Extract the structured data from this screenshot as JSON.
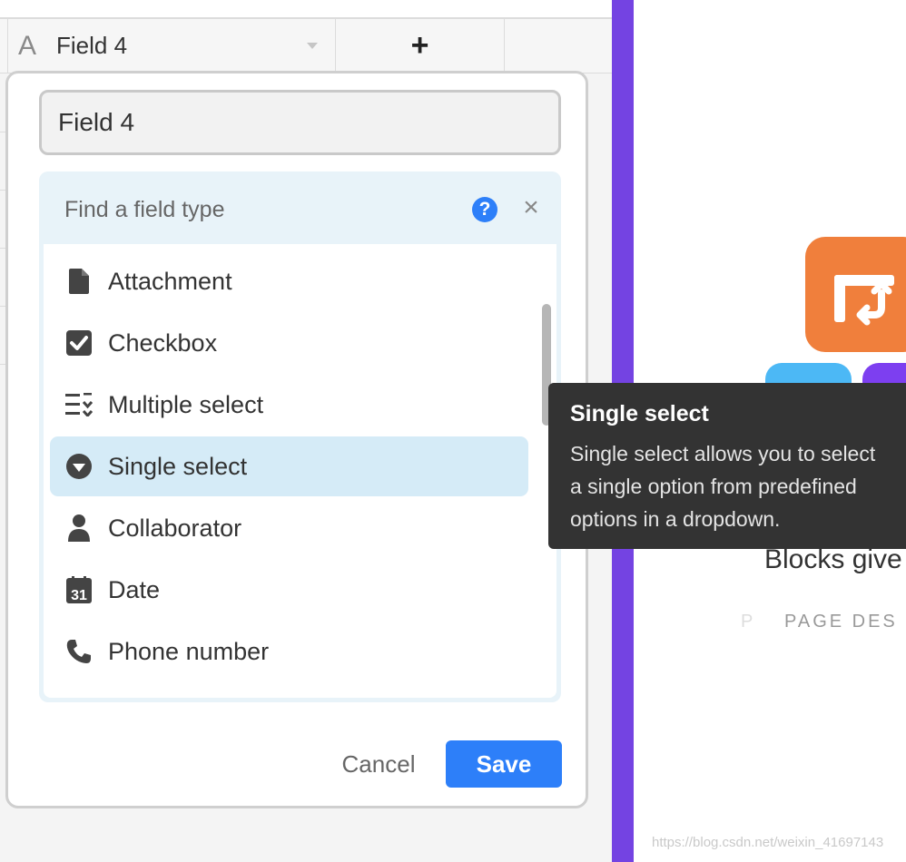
{
  "grid": {
    "field_header": {
      "icon": "text-field-icon",
      "name": "Field 4"
    },
    "add_column_label": "+"
  },
  "dialog": {
    "field_name_value": "Field 4",
    "search": {
      "placeholder": "Find a field type",
      "help_icon": "question-circle-icon",
      "help_label": "?",
      "close_icon": "close-icon",
      "close_label": "×"
    },
    "field_types": [
      {
        "label": "Attachment",
        "icon": "file-icon",
        "selected": false
      },
      {
        "label": "Checkbox",
        "icon": "checkbox-icon",
        "selected": false
      },
      {
        "label": "Multiple select",
        "icon": "multiple-select-icon",
        "selected": false
      },
      {
        "label": "Single select",
        "icon": "single-select-icon",
        "selected": true
      },
      {
        "label": "Collaborator",
        "icon": "user-icon",
        "selected": false
      },
      {
        "label": "Date",
        "icon": "calendar-icon",
        "selected": false
      },
      {
        "label": "Phone number",
        "icon": "phone-icon",
        "selected": false
      }
    ],
    "calendar_day": "31",
    "cancel_label": "Cancel",
    "save_label": "Save"
  },
  "tooltip": {
    "title": "Single select",
    "lines": [
      "Single select allows you to select",
      "a single option from predefined",
      "options in a dropdown."
    ]
  },
  "right_panel": {
    "blocks_text": "Blocks give",
    "page_prefix": "P",
    "page_desc": "PAGE DES"
  },
  "watermark": "https://blog.csdn.net/weixin_41697143",
  "colors": {
    "accent_blue": "#2d7ff9",
    "purple_bar": "#7443e2",
    "selected_row": "#d5ebf7",
    "picker_bg": "#e8f3f9",
    "orange_block": "#f07f3c",
    "tooltip_bg": "#333333"
  }
}
